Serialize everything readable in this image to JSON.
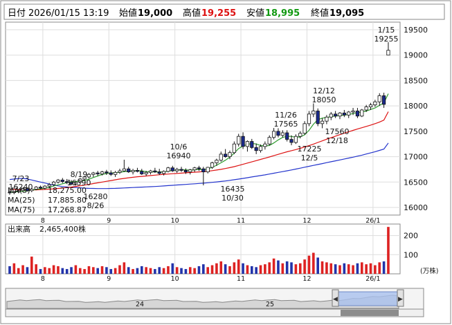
{
  "header": {
    "date_label": "日付",
    "datetime": "2026/01/15 13:19",
    "open_label": "始値",
    "open": "19,000",
    "high_label": "高値",
    "high": "19,255",
    "low_label": "安値",
    "low": "18,995",
    "close_label": "終値",
    "close": "19,095",
    "colors": {
      "high": "#dd1111",
      "low": "#119911",
      "text": "#111111"
    }
  },
  "chart_data": {
    "type": "candlestick",
    "price_axis": {
      "ticks": [
        "19500",
        "19000",
        "18500",
        "18000",
        "17500",
        "17000",
        "16500",
        "16000"
      ],
      "ylim": [
        15850,
        19650
      ]
    },
    "x_ticks": [
      "8",
      "9",
      "10",
      "11",
      "12",
      "26/1"
    ],
    "legend": [
      {
        "label": "MA(5)",
        "value": "18,275.00",
        "color": "#2e9b2e"
      },
      {
        "label": "MA(25)",
        "value": "17,885.80",
        "color": "#dd1111"
      },
      {
        "label": "MA(75)",
        "value": "17,268.87",
        "color": "#2233cc"
      }
    ],
    "annotations": [
      {
        "date": "7/23",
        "price": "16240"
      },
      {
        "date": "8/19",
        "price": "16390"
      },
      {
        "date": "8/26",
        "price": "16280"
      },
      {
        "date": "10/6",
        "price": "16940"
      },
      {
        "date": "10/30",
        "price": "16435"
      },
      {
        "date": "11/26",
        "price": "17565"
      },
      {
        "date": "12/5",
        "price": "17225"
      },
      {
        "date": "12/12",
        "price": "18050"
      },
      {
        "date": "12/18",
        "price": "17560"
      },
      {
        "date": "1/15",
        "price": "19255"
      }
    ],
    "candles": [
      {
        "d": 0,
        "o": 16300,
        "h": 16330,
        "l": 16250,
        "c": 16290
      },
      {
        "d": 1,
        "o": 16290,
        "h": 16320,
        "l": 16260,
        "c": 16310
      },
      {
        "d": 2,
        "o": 16310,
        "h": 16360,
        "l": 16280,
        "c": 16330
      },
      {
        "d": 3,
        "o": 16330,
        "h": 16390,
        "l": 16300,
        "c": 16370
      },
      {
        "d": 4,
        "o": 16370,
        "h": 16390,
        "l": 16310,
        "c": 16330
      },
      {
        "d": 5,
        "o": 16330,
        "h": 16380,
        "l": 16300,
        "c": 16360
      },
      {
        "d": 6,
        "o": 16360,
        "h": 16420,
        "l": 16340,
        "c": 16400
      },
      {
        "d": 7,
        "o": 16400,
        "h": 16430,
        "l": 16360,
        "c": 16380
      },
      {
        "d": 8,
        "o": 16380,
        "h": 16440,
        "l": 16350,
        "c": 16420
      },
      {
        "d": 9,
        "o": 16420,
        "h": 16480,
        "l": 16380,
        "c": 16450
      },
      {
        "d": 10,
        "o": 16450,
        "h": 16520,
        "l": 16420,
        "c": 16500
      },
      {
        "d": 11,
        "o": 16500,
        "h": 16560,
        "l": 16470,
        "c": 16540
      },
      {
        "d": 12,
        "o": 16540,
        "h": 16580,
        "l": 16480,
        "c": 16510
      },
      {
        "d": 13,
        "o": 16510,
        "h": 16560,
        "l": 16460,
        "c": 16490
      },
      {
        "d": 14,
        "o": 16490,
        "h": 16540,
        "l": 16440,
        "c": 16460
      },
      {
        "d": 15,
        "o": 16460,
        "h": 16520,
        "l": 16430,
        "c": 16500
      },
      {
        "d": 16,
        "o": 16500,
        "h": 16580,
        "l": 16480,
        "c": 16560
      },
      {
        "d": 17,
        "o": 16560,
        "h": 16620,
        "l": 16520,
        "c": 16600
      },
      {
        "d": 18,
        "o": 16600,
        "h": 16680,
        "l": 16570,
        "c": 16650
      },
      {
        "d": 19,
        "o": 16650,
        "h": 16700,
        "l": 16600,
        "c": 16680
      },
      {
        "d": 20,
        "o": 16680,
        "h": 16720,
        "l": 16620,
        "c": 16660
      },
      {
        "d": 21,
        "o": 16660,
        "h": 16720,
        "l": 16630,
        "c": 16700
      },
      {
        "d": 22,
        "o": 16700,
        "h": 16740,
        "l": 16640,
        "c": 16680
      },
      {
        "d": 23,
        "o": 16680,
        "h": 16730,
        "l": 16620,
        "c": 16650
      },
      {
        "d": 24,
        "o": 16650,
        "h": 16720,
        "l": 16600,
        "c": 16690
      },
      {
        "d": 25,
        "o": 16690,
        "h": 16760,
        "l": 16660,
        "c": 16720
      },
      {
        "d": 26,
        "o": 16720,
        "h": 16940,
        "l": 16700,
        "c": 16760
      },
      {
        "d": 27,
        "o": 16760,
        "h": 16800,
        "l": 16680,
        "c": 16700
      },
      {
        "d": 28,
        "o": 16700,
        "h": 16760,
        "l": 16650,
        "c": 16730
      },
      {
        "d": 29,
        "o": 16730,
        "h": 16780,
        "l": 16690,
        "c": 16710
      },
      {
        "d": 30,
        "o": 16710,
        "h": 16760,
        "l": 16640,
        "c": 16660
      },
      {
        "d": 31,
        "o": 16660,
        "h": 16720,
        "l": 16620,
        "c": 16690
      },
      {
        "d": 32,
        "o": 16690,
        "h": 16740,
        "l": 16650,
        "c": 16720
      },
      {
        "d": 33,
        "o": 16720,
        "h": 16780,
        "l": 16680,
        "c": 16700
      },
      {
        "d": 34,
        "o": 16700,
        "h": 16760,
        "l": 16640,
        "c": 16670
      },
      {
        "d": 35,
        "o": 16670,
        "h": 16730,
        "l": 16630,
        "c": 16710
      },
      {
        "d": 36,
        "o": 16710,
        "h": 16800,
        "l": 16690,
        "c": 16780
      },
      {
        "d": 37,
        "o": 16780,
        "h": 16820,
        "l": 16700,
        "c": 16720
      },
      {
        "d": 38,
        "o": 16720,
        "h": 16780,
        "l": 16680,
        "c": 16750
      },
      {
        "d": 39,
        "o": 16750,
        "h": 16800,
        "l": 16700,
        "c": 16730
      },
      {
        "d": 40,
        "o": 16730,
        "h": 16770,
        "l": 16660,
        "c": 16700
      },
      {
        "d": 41,
        "o": 16700,
        "h": 16760,
        "l": 16650,
        "c": 16740
      },
      {
        "d": 42,
        "o": 16740,
        "h": 16800,
        "l": 16700,
        "c": 16780
      },
      {
        "d": 43,
        "o": 16780,
        "h": 16820,
        "l": 16720,
        "c": 16760
      },
      {
        "d": 44,
        "o": 16760,
        "h": 16800,
        "l": 16435,
        "c": 16700
      },
      {
        "d": 45,
        "o": 16700,
        "h": 16800,
        "l": 16670,
        "c": 16790
      },
      {
        "d": 46,
        "o": 16790,
        "h": 16900,
        "l": 16760,
        "c": 16880
      },
      {
        "d": 47,
        "o": 16880,
        "h": 16960,
        "l": 16820,
        "c": 16930
      },
      {
        "d": 48,
        "o": 16930,
        "h": 17100,
        "l": 16900,
        "c": 17050
      },
      {
        "d": 49,
        "o": 17050,
        "h": 17150,
        "l": 16980,
        "c": 17000
      },
      {
        "d": 50,
        "o": 17000,
        "h": 17120,
        "l": 16950,
        "c": 17080
      },
      {
        "d": 51,
        "o": 17080,
        "h": 17300,
        "l": 17050,
        "c": 17250
      },
      {
        "d": 52,
        "o": 17250,
        "h": 17450,
        "l": 17200,
        "c": 17400
      },
      {
        "d": 53,
        "o": 17400,
        "h": 17480,
        "l": 17150,
        "c": 17200
      },
      {
        "d": 54,
        "o": 17200,
        "h": 17320,
        "l": 17100,
        "c": 17300
      },
      {
        "d": 55,
        "o": 17300,
        "h": 17350,
        "l": 17150,
        "c": 17180
      },
      {
        "d": 56,
        "o": 17180,
        "h": 17260,
        "l": 17050,
        "c": 17120
      },
      {
        "d": 57,
        "o": 17120,
        "h": 17240,
        "l": 17080,
        "c": 17200
      },
      {
        "d": 58,
        "o": 17200,
        "h": 17300,
        "l": 17140,
        "c": 17250
      },
      {
        "d": 59,
        "o": 17250,
        "h": 17420,
        "l": 17220,
        "c": 17380
      },
      {
        "d": 60,
        "o": 17380,
        "h": 17565,
        "l": 17340,
        "c": 17500
      },
      {
        "d": 61,
        "o": 17500,
        "h": 17560,
        "l": 17380,
        "c": 17420
      },
      {
        "d": 62,
        "o": 17420,
        "h": 17520,
        "l": 17380,
        "c": 17470
      },
      {
        "d": 63,
        "o": 17470,
        "h": 17520,
        "l": 17300,
        "c": 17340
      },
      {
        "d": 64,
        "o": 17340,
        "h": 17420,
        "l": 17225,
        "c": 17280
      },
      {
        "d": 65,
        "o": 17280,
        "h": 17440,
        "l": 17250,
        "c": 17400
      },
      {
        "d": 66,
        "o": 17400,
        "h": 17500,
        "l": 17360,
        "c": 17460
      },
      {
        "d": 67,
        "o": 17460,
        "h": 17700,
        "l": 17430,
        "c": 17650
      },
      {
        "d": 68,
        "o": 17650,
        "h": 17900,
        "l": 17600,
        "c": 17840
      },
      {
        "d": 69,
        "o": 17840,
        "h": 18050,
        "l": 17780,
        "c": 17900
      },
      {
        "d": 70,
        "o": 17900,
        "h": 17950,
        "l": 17600,
        "c": 17650
      },
      {
        "d": 71,
        "o": 17650,
        "h": 17760,
        "l": 17560,
        "c": 17700
      },
      {
        "d": 72,
        "o": 17700,
        "h": 17820,
        "l": 17640,
        "c": 17780
      },
      {
        "d": 73,
        "o": 17780,
        "h": 17880,
        "l": 17720,
        "c": 17840
      },
      {
        "d": 74,
        "o": 17840,
        "h": 17900,
        "l": 17760,
        "c": 17800
      },
      {
        "d": 75,
        "o": 17800,
        "h": 17880,
        "l": 17740,
        "c": 17860
      },
      {
        "d": 76,
        "o": 17860,
        "h": 17920,
        "l": 17780,
        "c": 17820
      },
      {
        "d": 77,
        "o": 17820,
        "h": 17900,
        "l": 17760,
        "c": 17880
      },
      {
        "d": 78,
        "o": 17880,
        "h": 17960,
        "l": 17820,
        "c": 17900
      },
      {
        "d": 79,
        "o": 17900,
        "h": 17960,
        "l": 17760,
        "c": 17800
      },
      {
        "d": 80,
        "o": 17800,
        "h": 17940,
        "l": 17780,
        "c": 17920
      },
      {
        "d": 81,
        "o": 17920,
        "h": 18020,
        "l": 17880,
        "c": 17980
      },
      {
        "d": 82,
        "o": 17980,
        "h": 18060,
        "l": 17920,
        "c": 18020
      },
      {
        "d": 83,
        "o": 18020,
        "h": 18120,
        "l": 17980,
        "c": 18080
      },
      {
        "d": 84,
        "o": 18080,
        "h": 18250,
        "l": 18000,
        "c": 18200
      },
      {
        "d": 85,
        "o": 18200,
        "h": 18260,
        "l": 17960,
        "c": 18030
      },
      {
        "d": 86,
        "o": 19000,
        "h": 19255,
        "l": 18995,
        "c": 19095
      }
    ],
    "ma5": [
      16300,
      16305,
      16310,
      16320,
      16330,
      16340,
      16355,
      16365,
      16380,
      16395,
      16420,
      16445,
      16465,
      16490,
      16505,
      16510,
      16515,
      16530,
      16555,
      16590,
      16620,
      16650,
      16670,
      16680,
      16685,
      16690,
      16705,
      16715,
      16720,
      16725,
      16720,
      16705,
      16700,
      16700,
      16700,
      16700,
      16715,
      16730,
      16735,
      16745,
      16740,
      16735,
      16740,
      16750,
      16740,
      16760,
      16790,
      16830,
      16880,
      16930,
      16990,
      17070,
      17160,
      17210,
      17240,
      17260,
      17250,
      17220,
      17210,
      17220,
      17270,
      17330,
      17380,
      17400,
      17400,
      17380,
      17390,
      17430,
      17520,
      17640,
      17730,
      17760,
      17770,
      17790,
      17800,
      17810,
      17820,
      17830,
      17850,
      17870,
      17880,
      17900,
      17930,
      17960,
      18010,
      18060,
      18240
    ],
    "ma25": [
      16360,
      16355,
      16350,
      16348,
      16346,
      16345,
      16346,
      16350,
      16355,
      16360,
      16366,
      16374,
      16382,
      16392,
      16402,
      16414,
      16426,
      16440,
      16455,
      16470,
      16485,
      16500,
      16515,
      16530,
      16545,
      16560,
      16572,
      16584,
      16594,
      16604,
      16612,
      16620,
      16628,
      16636,
      16644,
      16652,
      16658,
      16664,
      16670,
      16676,
      16682,
      16688,
      16694,
      16700,
      16706,
      16714,
      16724,
      16736,
      16750,
      16766,
      16784,
      16804,
      16826,
      16850,
      16874,
      16898,
      16922,
      16946,
      16970,
      16994,
      17020,
      17046,
      17072,
      17096,
      17118,
      17140,
      17164,
      17190,
      17218,
      17248,
      17280,
      17312,
      17344,
      17374,
      17404,
      17434,
      17462,
      17490,
      17518,
      17544,
      17570,
      17596,
      17622,
      17650,
      17680,
      17720,
      17886
    ],
    "ma75": [
      16550,
      16560,
      16568,
      16572,
      16560,
      16540,
      16520,
      16500,
      16480,
      16460,
      16440,
      16425,
      16412,
      16404,
      16398,
      16392,
      16386,
      16380,
      16376,
      16374,
      16372,
      16372,
      16372,
      16374,
      16376,
      16380,
      16384,
      16388,
      16392,
      16396,
      16400,
      16404,
      16408,
      16412,
      16418,
      16424,
      16430,
      16436,
      16442,
      16448,
      16454,
      16460,
      16466,
      16472,
      16478,
      16486,
      16494,
      16502,
      16512,
      16522,
      16534,
      16546,
      16558,
      16572,
      16586,
      16600,
      16614,
      16628,
      16642,
      16658,
      16674,
      16690,
      16706,
      16722,
      16738,
      16756,
      16774,
      16792,
      16810,
      16828,
      16846,
      16864,
      16882,
      16900,
      16918,
      16936,
      16954,
      16972,
      16990,
      17010,
      17030,
      17052,
      17074,
      17098,
      17124,
      17150,
      17269
    ],
    "volume": {
      "label": "出来高",
      "value": "2,465,400株",
      "unit": "(万株)",
      "ticks": [
        "200",
        "100"
      ],
      "ymax": 260,
      "values": [
        40,
        55,
        30,
        45,
        35,
        90,
        50,
        25,
        35,
        30,
        45,
        40,
        30,
        25,
        35,
        45,
        30,
        25,
        40,
        35,
        30,
        40,
        35,
        25,
        30,
        45,
        60,
        35,
        25,
        30,
        40,
        35,
        30,
        25,
        35,
        30,
        40,
        55,
        35,
        30,
        25,
        35,
        30,
        40,
        50,
        35,
        45,
        55,
        65,
        50,
        40,
        60,
        75,
        55,
        45,
        40,
        35,
        45,
        50,
        60,
        80,
        70,
        55,
        65,
        60,
        50,
        55,
        75,
        95,
        110,
        85,
        65,
        60,
        55,
        50,
        45,
        55,
        50,
        45,
        55,
        60,
        50,
        55,
        45,
        60,
        65,
        245
      ]
    },
    "navigator": {
      "ticks": [
        "24",
        "25"
      ]
    }
  }
}
